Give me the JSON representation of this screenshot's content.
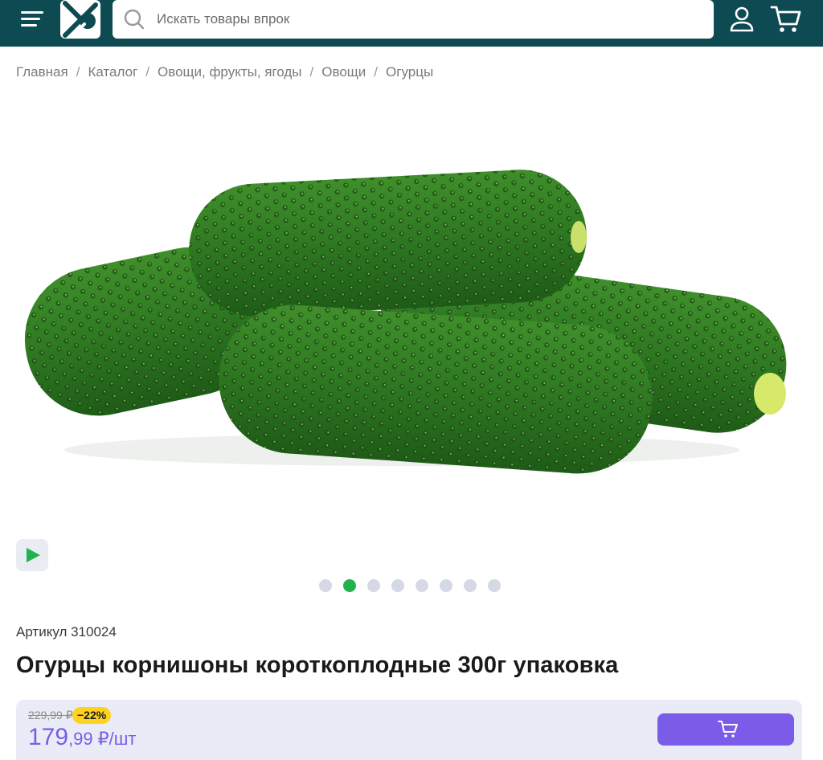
{
  "header": {
    "search_placeholder": "Искать товары впрок",
    "icons": {
      "menu": "hamburger-menu-icon",
      "logo": "brand-logo-icon",
      "search": "search-icon",
      "user": "user-icon",
      "cart": "cart-icon"
    },
    "colors": {
      "bar": "#0d4a52",
      "accent": "#7b5ce8"
    }
  },
  "breadcrumb": [
    {
      "label": "Главная"
    },
    {
      "label": "Каталог"
    },
    {
      "label": "Овощи, фрукты, ягоды"
    },
    {
      "label": "Овощи"
    },
    {
      "label": "Огурцы"
    }
  ],
  "breadcrumb_separator": "/",
  "gallery": {
    "slides_total": 8,
    "active_slide": 2,
    "video_icon": "play-icon"
  },
  "product": {
    "sku": "Артикул 310024",
    "title": "Огурцы корнишоны короткоплодные 300г упаковка",
    "old_price": "229,99 ₽",
    "discount": "−22%",
    "price_rub": "179",
    "price_kop": ",99",
    "price_unit": "₽/шт",
    "add_to_cart_icon": "cart-icon"
  }
}
